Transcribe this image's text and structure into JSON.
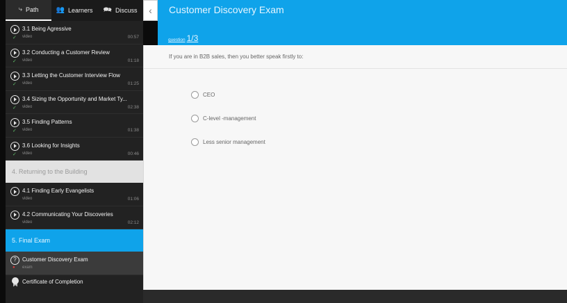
{
  "sidebar": {
    "tabs": [
      {
        "label": "Path",
        "icon": "path-icon"
      },
      {
        "label": "Learners",
        "icon": "people-icon"
      },
      {
        "label": "Discuss",
        "icon": "chat-icon"
      }
    ],
    "items_a": [
      {
        "title": "3.1 Being Agressive",
        "type": "video",
        "duration": "00:57"
      },
      {
        "title": "3.2 Conducting a Customer Review",
        "type": "video",
        "duration": "01:18"
      },
      {
        "title": "3.3 Letting the Customer Interview Flow",
        "type": "video",
        "duration": "01:25"
      },
      {
        "title": "3.4 Sizing the Opportunity and Market Ty...",
        "type": "video",
        "duration": "02:38"
      },
      {
        "title": "3.5 Finding Patterns",
        "type": "video",
        "duration": "01:38"
      },
      {
        "title": "3.6 Looking for Insights",
        "type": "video",
        "duration": "00:46"
      }
    ],
    "section_4": "4. Returning to the Building",
    "items_b": [
      {
        "title": "4.1 Finding Early Evangelists",
        "type": "video",
        "duration": "01:06"
      },
      {
        "title": "4.2 Communicating Your Discoveries",
        "type": "video",
        "duration": "02:12"
      }
    ],
    "section_5": "5. Final Exam",
    "exam_item": {
      "title": "Customer Discovery Exam",
      "type": "exam"
    },
    "certificate": "Certificate of Completion"
  },
  "header": {
    "title": "Customer Discovery Exam",
    "question_word": "question",
    "question_count": "1/3"
  },
  "main": {
    "question_text": "If you are in B2B sales, then you better speak firstly to:",
    "options": [
      "CEO",
      "C-level -management",
      "Less senior management"
    ]
  },
  "colors": {
    "accent": "#0fa3ea",
    "sidebar_bg": "#222222",
    "complete_check": "#5fbf6a"
  }
}
